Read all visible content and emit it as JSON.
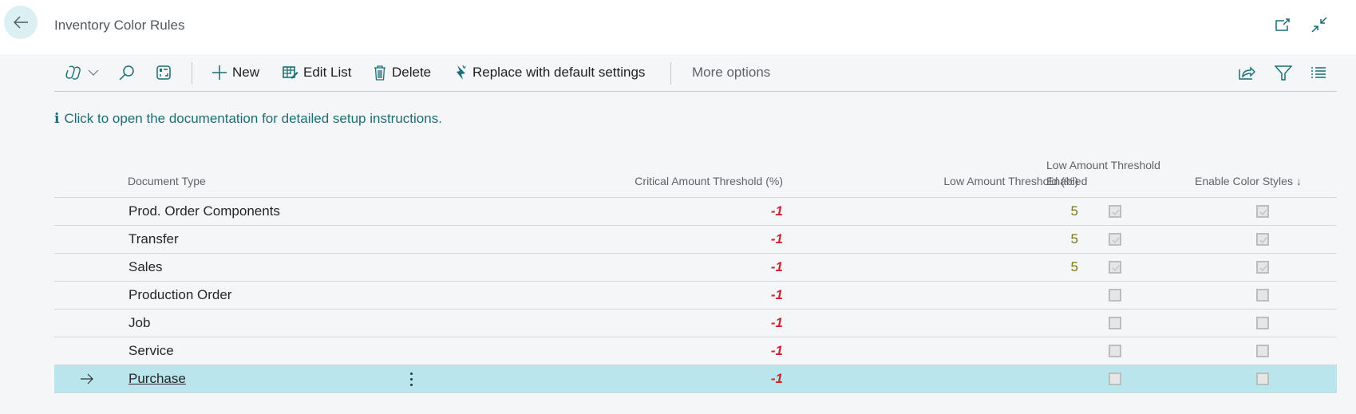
{
  "header": {
    "title": "Inventory Color Rules",
    "back_icon": "arrow-left-icon",
    "open_new_window_icon": "open-in-new-window-icon",
    "collapse_icon": "collapse-icon"
  },
  "actionbar": {
    "copilot_icon": "copilot-icon",
    "search_icon": "search-icon",
    "layout_icon": "layout-toggle-icon",
    "new_label": "New",
    "edit_list_label": "Edit List",
    "delete_label": "Delete",
    "replace_label": "Replace with default settings",
    "more_options_label": "More options",
    "share_icon": "share-icon",
    "filter_icon": "filter-icon",
    "list_icon": "list-view-icon"
  },
  "info": {
    "icon": "info-icon",
    "icon_glyph": "i",
    "text": "Click to open the documentation for detailed setup instructions."
  },
  "table": {
    "columns": {
      "document_type": "Document Type",
      "critical": "Critical Amount Threshold (%)",
      "low": "Low Amount Threshold (%)",
      "low_enabled_line1": "Low Amount Threshold",
      "low_enabled_line2": "Enabled",
      "enable_color_styles": "Enable Color Styles",
      "sort_indicator": "↓"
    },
    "rows": [
      {
        "document_type": "Prod. Order Components",
        "critical": "-1",
        "low": "5",
        "low_enabled": true,
        "color_styles": true
      },
      {
        "document_type": "Transfer",
        "critical": "-1",
        "low": "5",
        "low_enabled": true,
        "color_styles": true
      },
      {
        "document_type": "Sales",
        "critical": "-1",
        "low": "5",
        "low_enabled": true,
        "color_styles": true
      },
      {
        "document_type": "Production Order",
        "critical": "-1",
        "low": "",
        "low_enabled": false,
        "color_styles": false
      },
      {
        "document_type": "Job",
        "critical": "-1",
        "low": "",
        "low_enabled": false,
        "color_styles": false
      },
      {
        "document_type": "Service",
        "critical": "-1",
        "low": "",
        "low_enabled": false,
        "color_styles": false
      },
      {
        "document_type": "Purchase",
        "critical": "-1",
        "low": "",
        "low_enabled": false,
        "color_styles": false,
        "selected": true
      }
    ]
  },
  "colors": {
    "accent": "#1a6f74",
    "critical": "#d1242a",
    "low": "#7d7413",
    "selected_row": "#b8e6ec"
  }
}
